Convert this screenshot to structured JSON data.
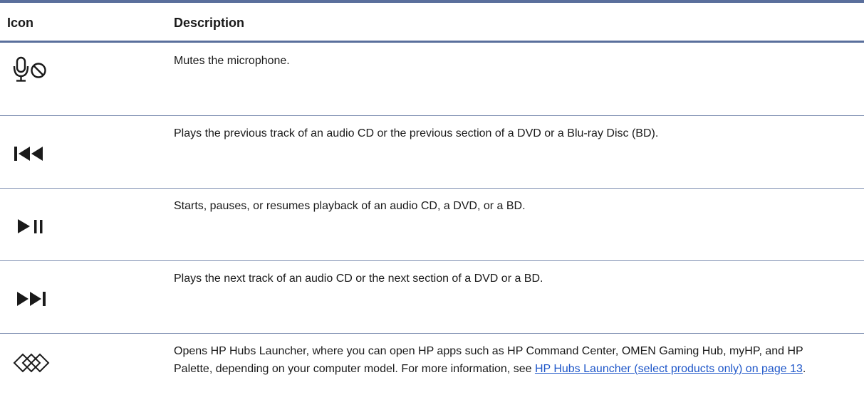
{
  "table": {
    "headers": {
      "icon": "Icon",
      "description": "Description"
    },
    "rows": [
      {
        "icon": "mute-microphone-icon",
        "description": "Mutes the microphone."
      },
      {
        "icon": "previous-track-icon",
        "description": "Plays the previous track of an audio CD or the previous section of a DVD or a Blu-ray Disc (BD)."
      },
      {
        "icon": "play-pause-icon",
        "description": "Starts, pauses, or resumes playback of an audio CD, a DVD, or a BD."
      },
      {
        "icon": "next-track-icon",
        "description": "Plays the next track of an audio CD or the next section of a DVD or a BD."
      },
      {
        "icon": "hp-hubs-launcher-icon",
        "description_before_link": "Opens HP Hubs Launcher, where you can open HP apps such as HP Command Center, OMEN Gaming Hub, myHP, and HP Palette, depending on your computer model. For more information, see ",
        "link_text": "HP Hubs Launcher (select products only) on page 13",
        "description_after_link": "."
      }
    ]
  },
  "colors": {
    "rule": "#5a6f9c",
    "link": "#1f57c9",
    "text": "#1a1a1a"
  }
}
